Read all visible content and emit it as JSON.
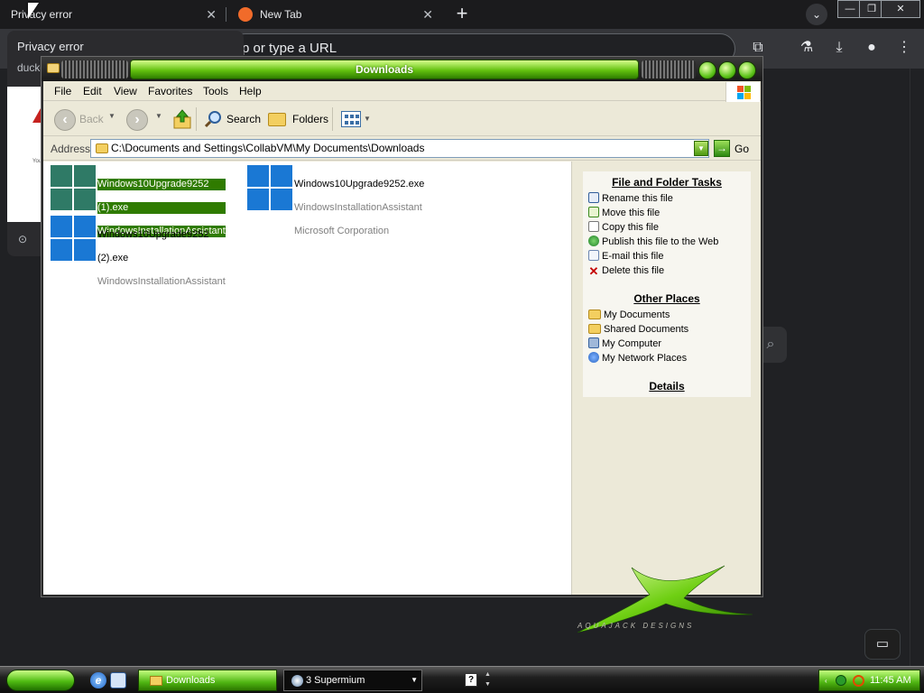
{
  "browser": {
    "tabs": [
      {
        "title": "Privacy error",
        "close": "✕"
      },
      {
        "title": "New Tab",
        "close": "✕"
      }
    ],
    "new_tab": "+",
    "tab_search": "⌄",
    "window_controls": {
      "minimize": "—",
      "maximize": "❐",
      "close": "✕"
    },
    "omnibox_placeholder": "Search Google or type a URL",
    "omnibox_visible_text": "p or type a URL",
    "hover_card": {
      "title": "Privacy error",
      "url": "duckd",
      "thumbnail_text": "You",
      "footer": "⊙"
    },
    "toolbar_icons": [
      "extensions-icon",
      "labs-icon",
      "download-icon",
      "profile-icon",
      "menu-icon"
    ],
    "search_glyph": "⌕",
    "feedback_glyph": "▭"
  },
  "window": {
    "title": "Downloads",
    "menu": [
      "File",
      "Edit",
      "View",
      "Favorites",
      "Tools",
      "Help"
    ],
    "toolbar": {
      "back": "Back",
      "search": "Search",
      "folders": "Folders"
    },
    "address": {
      "label": "Address",
      "value": "C:\\Documents and Settings\\CollabVM\\My Documents\\Downloads",
      "go": "Go"
    },
    "files": [
      {
        "line1": "Windows10Upgrade9252",
        "line2": "(1).exe",
        "line3": "WindowsInstallationAssistant",
        "selected": true,
        "icon_color": "#2f7a66"
      },
      {
        "line1": "Windows10Upgrade9252.exe",
        "line2": "WindowsInstallationAssistant",
        "line3": "Microsoft Corporation",
        "selected": false,
        "icon_color": "#1a78d4"
      },
      {
        "line1": "Windows10Upgrade9252",
        "line2": "(2).exe",
        "line3": "WindowsInstallationAssistant",
        "selected": false,
        "icon_color": "#1a78d4"
      }
    ],
    "tasks": {
      "file_tasks_title": "File and Folder Tasks",
      "file_tasks": [
        "Rename this file",
        "Move this file",
        "Copy this file",
        "Publish this file to the Web",
        "E-mail this file",
        "Delete this file"
      ],
      "other_places_title": "Other Places",
      "other_places": [
        "My Documents",
        "Shared Documents",
        "My Computer",
        "My Network Places"
      ],
      "details_title": "Details"
    },
    "watermark_text": "AQUAJACK  DESIGNS"
  },
  "taskbar": {
    "buttons": [
      {
        "label": "Downloads"
      },
      {
        "label": "3 Supermium"
      }
    ],
    "help_glyph": "?",
    "clock": "11:45 AM"
  },
  "colors": {
    "accent_green": "#4fb512",
    "selection": "#2f7b00",
    "chrome_dark": "#202124"
  }
}
